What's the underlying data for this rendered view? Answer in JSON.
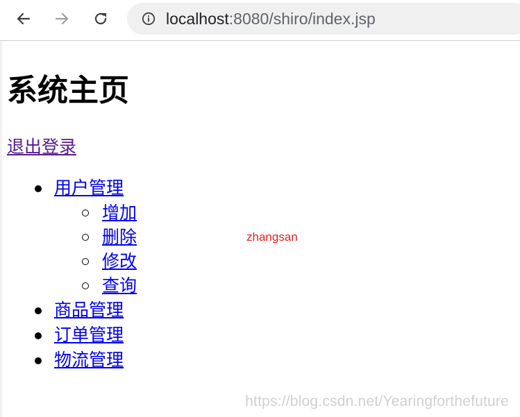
{
  "browser": {
    "url_host": "localhost",
    "url_rest": ":8080/shiro/index.jsp",
    "icons": {
      "back": "arrow-left-icon",
      "forward": "arrow-right-icon",
      "reload": "reload-icon",
      "site_info": "info-icon"
    }
  },
  "page": {
    "title": "系统主页",
    "logout_label": "退出登录",
    "menu": [
      {
        "label": "用户管理",
        "children": [
          "增加",
          "删除",
          "修改",
          "查询"
        ]
      },
      {
        "label": "商品管理"
      },
      {
        "label": "订单管理"
      },
      {
        "label": "物流管理"
      }
    ],
    "username": "zhangsan"
  },
  "watermark": "https://blog.csdn.net/Yearingforthefuture",
  "colors": {
    "link": "#0000ee",
    "visited_link": "#551a8b",
    "username": "#e0201b"
  }
}
